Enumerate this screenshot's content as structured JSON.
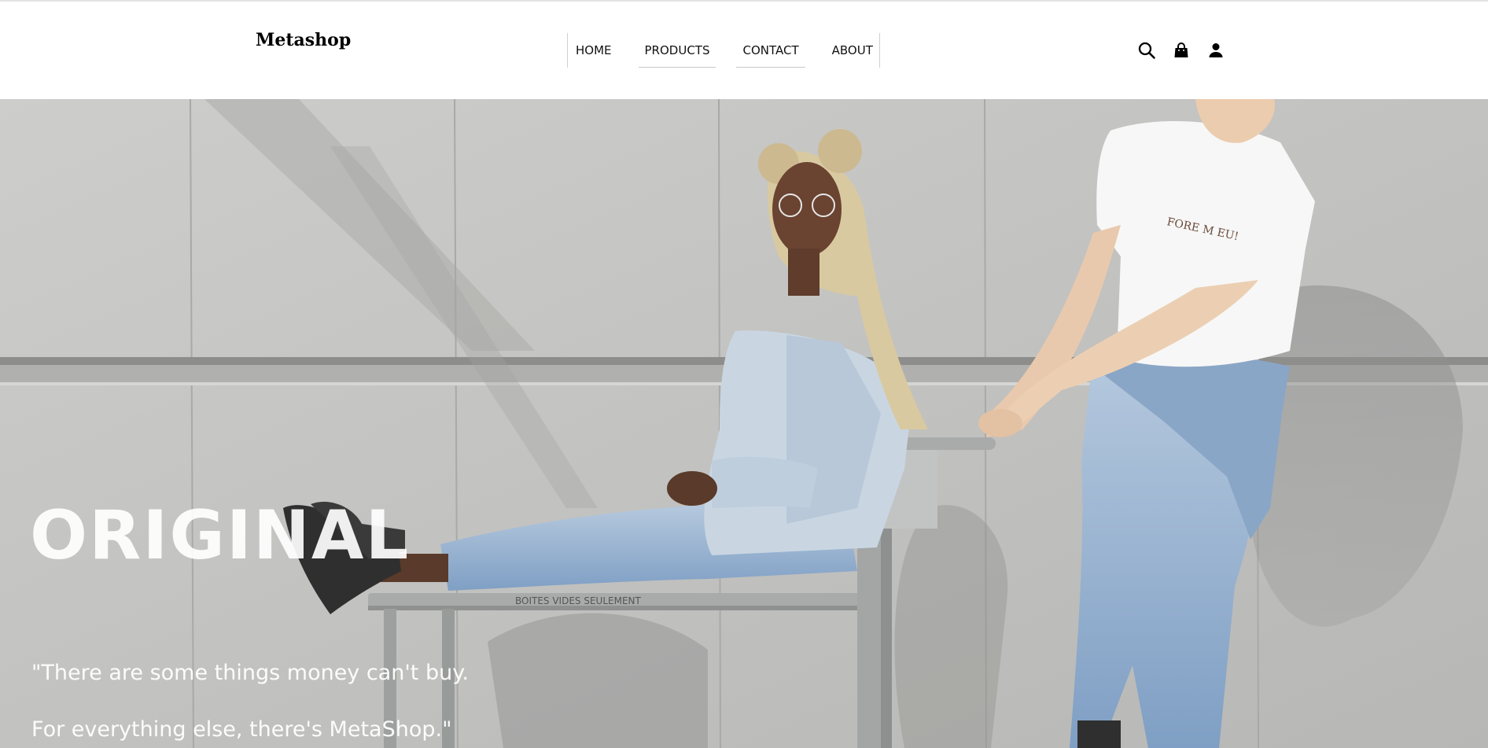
{
  "header": {
    "logo": "Metashop",
    "nav": [
      {
        "label": "HOME"
      },
      {
        "label": "PRODUCTS"
      },
      {
        "label": "CONTACT"
      },
      {
        "label": "ABOUT"
      }
    ],
    "icons": [
      "search-icon",
      "shopping-bag-icon",
      "user-icon"
    ]
  },
  "hero": {
    "headline": "ORIGINAL",
    "quote_line1": "\"There are some things money can't buy.",
    "quote_line2": "For everything else, there's MetaShop.\"",
    "bench_sign": "BOITES VIDES SEULEMENT"
  },
  "colors": {
    "wall": "#c3c3c1",
    "text_light": "#ffffff",
    "denim": "#9fb9d6",
    "shirt": "#f8f8f8"
  }
}
